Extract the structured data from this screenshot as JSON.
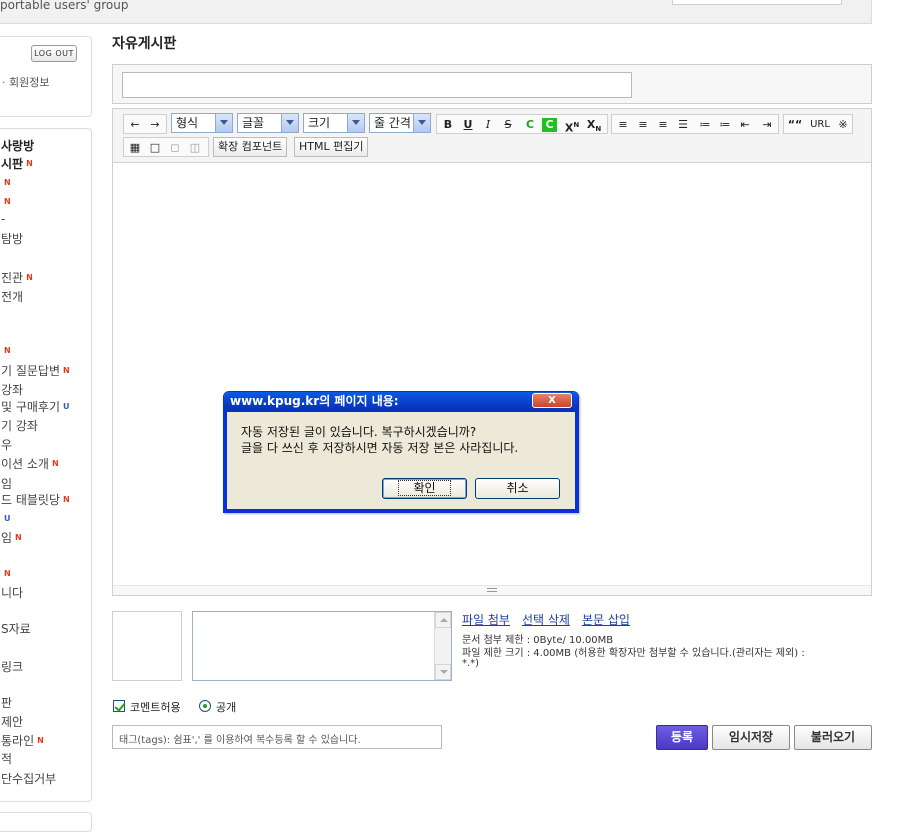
{
  "header": {
    "tagline": "portable users' group"
  },
  "sidebar": {
    "logout_label": "LOG OUT",
    "member_info_label": "· 회원정보",
    "menu_items": [
      {
        "label": "사랑방",
        "bold": true
      },
      {
        "label": "시판",
        "bold": true,
        "badge": "N"
      },
      {
        "label": "",
        "badge": "N"
      },
      {
        "label": "",
        "badge": "N"
      },
      {
        "label": "-"
      },
      {
        "label": "탐방"
      },
      {
        "label": "진관",
        "badge": "N"
      },
      {
        "label": "전개"
      },
      {
        "label": "",
        "badge": "N"
      },
      {
        "label": "기 질문답변",
        "badge": "N"
      },
      {
        "label": "강좌"
      },
      {
        "label": "및 구매후기",
        "badge": "U"
      },
      {
        "label": "기 강좌"
      },
      {
        "label": "우"
      },
      {
        "label": "이션 소개",
        "badge": "N"
      },
      {
        "label": "임"
      },
      {
        "label": "드 태블릿당",
        "badge": "N"
      },
      {
        "label": "",
        "badge": "U"
      },
      {
        "label": "임",
        "badge": "N"
      },
      {
        "label": "",
        "badge": "N"
      },
      {
        "label": "니다"
      },
      {
        "label": "S자료"
      },
      {
        "label": "링크"
      },
      {
        "label": "판"
      },
      {
        "label": "제안"
      },
      {
        "label": "통라인",
        "badge": "N"
      },
      {
        "label": "적"
      },
      {
        "label": "단수집거부"
      }
    ]
  },
  "main": {
    "page_title": "자유게시판",
    "title_input_value": ""
  },
  "toolbar": {
    "undo_icon": "undo-arrow-icon",
    "redo_icon": "redo-arrow-icon",
    "format_select": "형식",
    "font_select": "글꼴",
    "size_select": "크기",
    "line_height_select": "줄 간격",
    "bold": "B",
    "underline": "U",
    "italic": "I",
    "strike": "S",
    "text_color": "C",
    "bg_color": "C",
    "superscript": "X",
    "subscript": "X",
    "quote": "““",
    "url": "URL",
    "special_char": "※",
    "extension_component": "확장 컴포넌트",
    "html_editor": "HTML 편집기",
    "colors": {
      "text_color": "#21a121",
      "bg_color": "#21c021"
    }
  },
  "attachments": {
    "file_attach": "파일 첨부",
    "delete_selected": "선택 삭제",
    "insert_body": "본문 삽입",
    "limit_line": "문서 첨부 제한 : 0Byte/ 10.00MB",
    "size_line_1": "파일 제한 크기 : 4.00MB (허용한 확장자만 첨부할 수 있습니다.(관리자는 제외) :",
    "size_line_2": "*.*)"
  },
  "options": {
    "allow_comments": "코멘트허용",
    "public": "공개",
    "tag_placeholder": "태그(tags): 쉼표',' 를 이용하여 복수등록 할 수 있습니다."
  },
  "buttons": {
    "submit": "등록",
    "temp_save": "임시저장",
    "load": "불러오기",
    "colors": {
      "submit": "#4b38c7"
    }
  },
  "dialog": {
    "title": "www.kpug.kr의 페이지 내용:",
    "close": "X",
    "message_1": "자동 저장된 글이 있습니다. 복구하시겠습니까?",
    "message_2": "글을 다 쓰신 후 저장하시면 자동 저장 본은 사라집니다.",
    "ok": "확인",
    "cancel": "취소"
  }
}
